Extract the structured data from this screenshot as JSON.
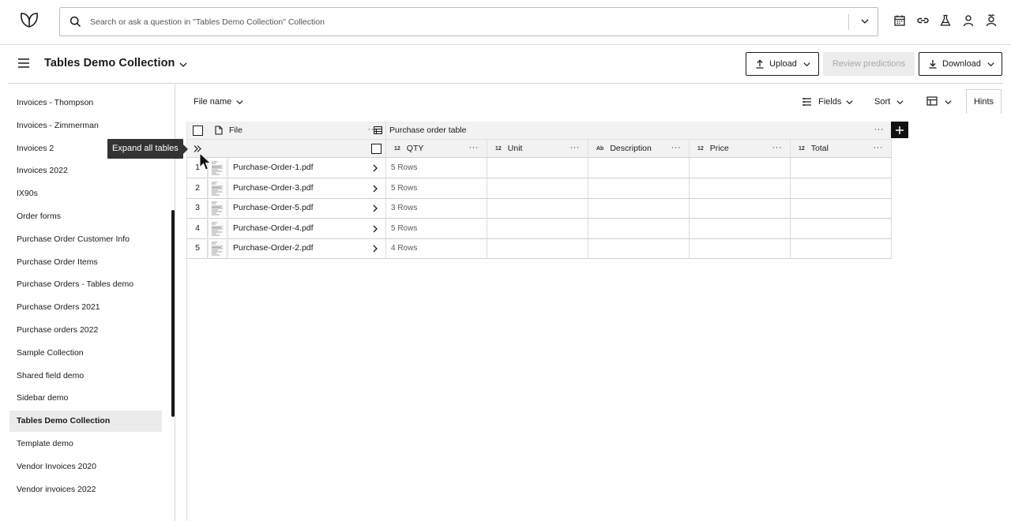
{
  "header": {
    "search_placeholder": "Search or ask a question in \"Tables Demo Collection\" Collection"
  },
  "collection": {
    "title": "Tables Demo Collection"
  },
  "actions": {
    "upload_label": "Upload",
    "review_label": "Review predictions",
    "download_label": "Download"
  },
  "sidebar": {
    "items": [
      {
        "label": "Invoices - Thompson"
      },
      {
        "label": "Invoices - Zimmerman"
      },
      {
        "label": "Invoices 2"
      },
      {
        "label": "Invoices 2022"
      },
      {
        "label": "IX90s"
      },
      {
        "label": "Order forms"
      },
      {
        "label": "Purchase Order Customer Info"
      },
      {
        "label": "Purchase Order Items"
      },
      {
        "label": "Purchase Orders - Tables demo"
      },
      {
        "label": "Purchase Orders 2021"
      },
      {
        "label": "Purchase orders 2022"
      },
      {
        "label": "Sample Collection"
      },
      {
        "label": "Shared field demo"
      },
      {
        "label": "Sidebar demo"
      },
      {
        "label": "Tables Demo Collection",
        "active": true
      },
      {
        "label": "Template demo"
      },
      {
        "label": "Vendor Invoices 2020"
      },
      {
        "label": "Vendor invoices 2022"
      }
    ]
  },
  "toolbar": {
    "filename_label": "File name",
    "fields_label": "Fields",
    "sort_label": "Sort",
    "hints_label": "Hints"
  },
  "table": {
    "file_header": "File",
    "group_header": "Purchase order table",
    "columns": [
      {
        "type": "12",
        "label": "QTY"
      },
      {
        "type": "12",
        "label": "Unit"
      },
      {
        "type": "Ab",
        "label": "Description"
      },
      {
        "type": "12",
        "label": "Price"
      },
      {
        "type": "12",
        "label": "Total"
      }
    ],
    "rows": [
      {
        "num": "1",
        "file": "Purchase-Order-1.pdf",
        "rows": "5 Rows"
      },
      {
        "num": "2",
        "file": "Purchase-Order-3.pdf",
        "rows": "5 Rows"
      },
      {
        "num": "3",
        "file": "Purchase-Order-5.pdf",
        "rows": "3 Rows"
      },
      {
        "num": "4",
        "file": "Purchase-Order-4.pdf",
        "rows": "5 Rows"
      },
      {
        "num": "5",
        "file": "Purchase-Order-2.pdf",
        "rows": "4 Rows"
      }
    ]
  },
  "tooltip": {
    "text": "Expand all tables"
  }
}
